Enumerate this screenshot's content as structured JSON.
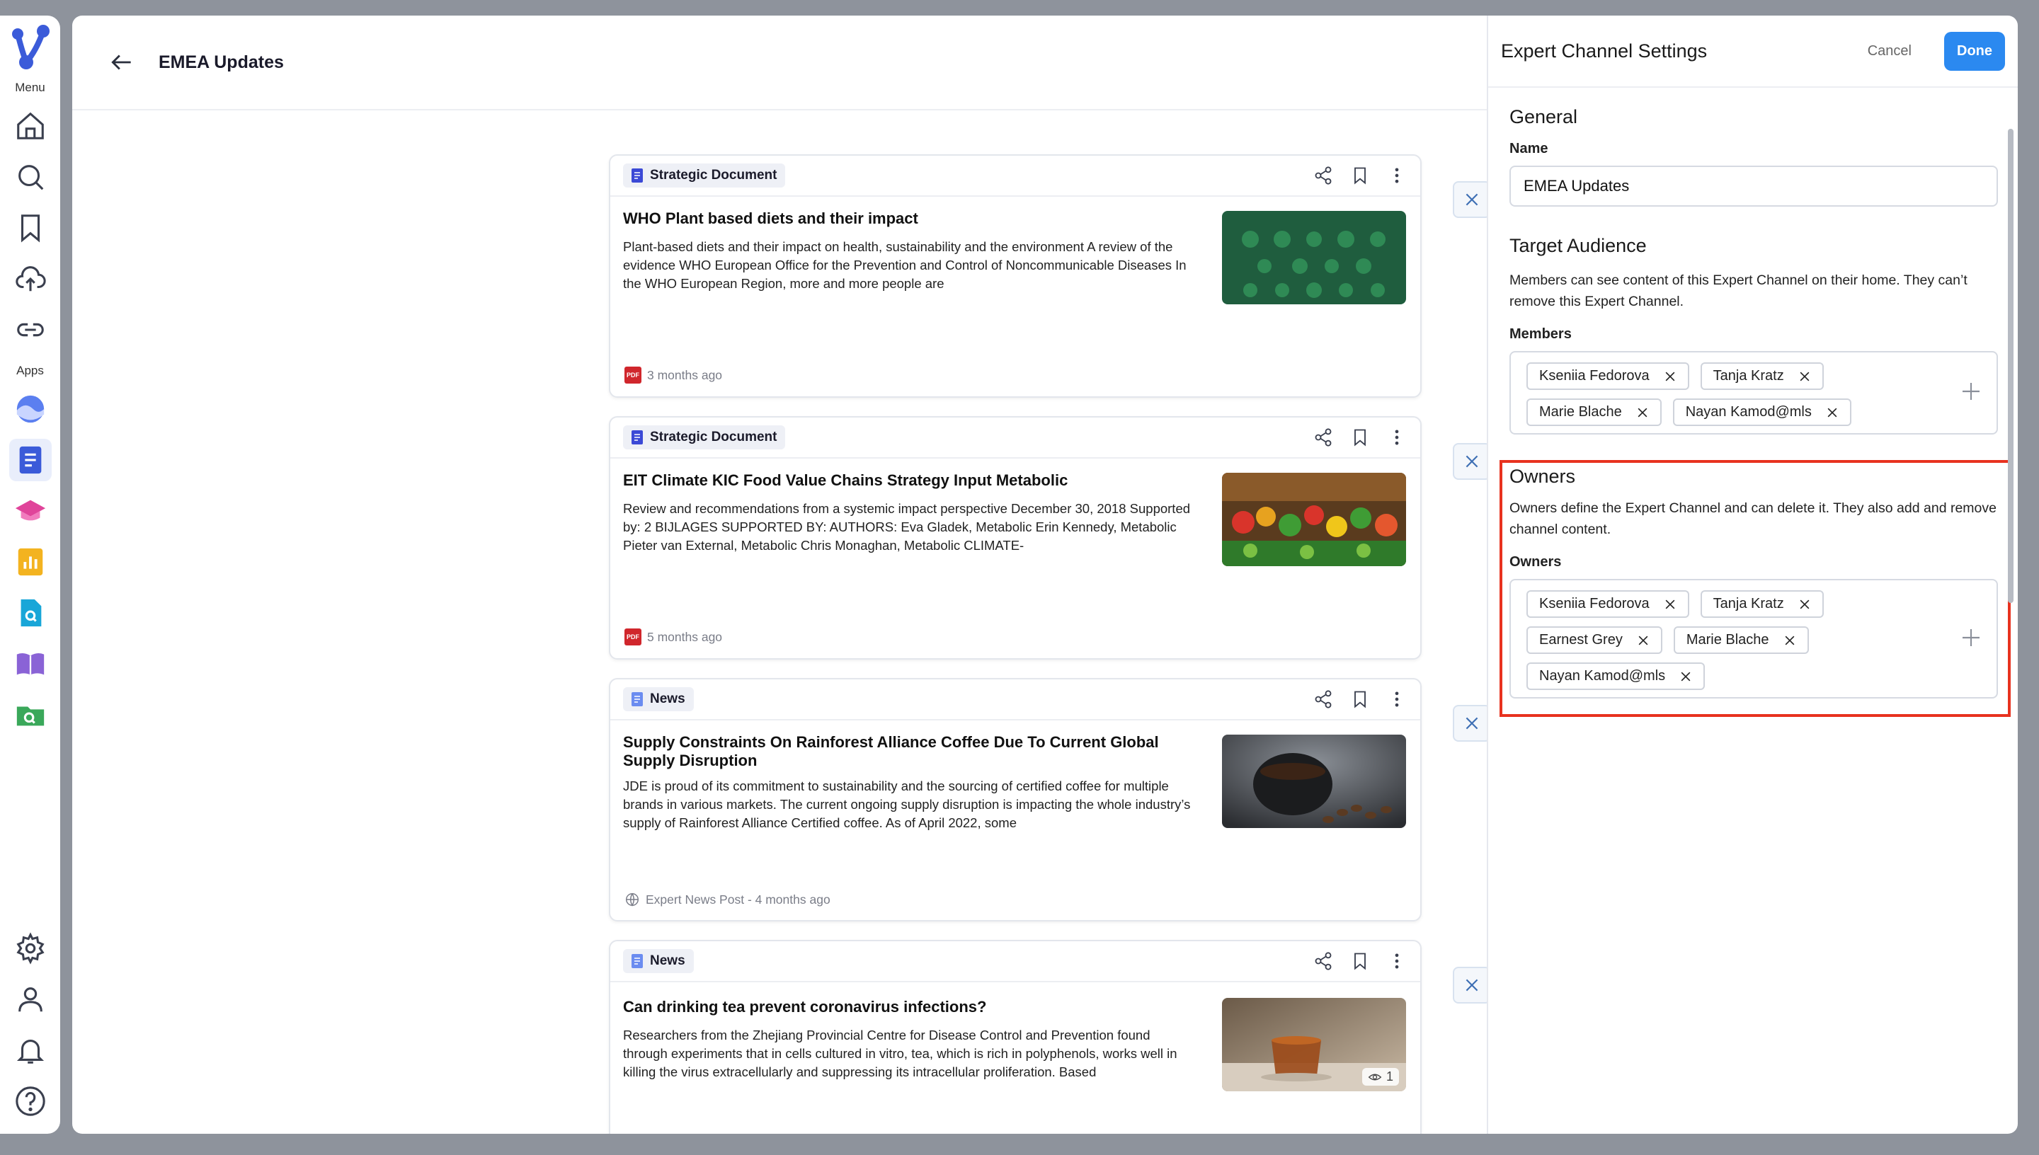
{
  "rail": {
    "menu_label": "Menu",
    "apps_label": "Apps"
  },
  "header": {
    "title": "EMEA Updates"
  },
  "cards": [
    {
      "tag": "Strategic Document",
      "title": "WHO Plant based diets and their impact",
      "desc": "Plant-based diets and their impact on health, sustainability and the environment A review of the evidence WHO European Office for the Prevention and Control of Noncommunicable Diseases In the WHO European Region, more and more people are",
      "meta": "3 months ago",
      "meta_icon": "pdf-icon",
      "thumb": "vegetables-icons"
    },
    {
      "tag": "Strategic Document",
      "title": "EIT Climate KIC Food Value Chains Strategy Input Metabolic",
      "desc": "Review and recommendations from a systemic impact perspective December 30, 2018 Supported by: 2 BIJLAGES SUPPORTED BY: AUTHORS: Eva Gladek, Metabolic Erin Kennedy, Metabolic Pieter van External, Metabolic Chris Monaghan, Metabolic CLIMATE-",
      "meta": "5 months ago",
      "meta_icon": "pdf-icon",
      "thumb": "market-produce"
    },
    {
      "tag": "News",
      "title": "Supply Constraints On Rainforest Alliance Coffee Due To Current Global Supply Disruption",
      "desc": "JDE is proud of its commitment to sustainability and the sourcing of certified coffee for multiple brands in various markets. The current ongoing supply disruption is impacting the whole industry’s supply of Rainforest Alliance Certified coffee. As of April 2022, some",
      "meta": "Expert News Post - 4 months ago",
      "meta_icon": "globe-icon",
      "thumb": "coffee-cup"
    },
    {
      "tag": "News",
      "title": "Can drinking tea prevent coronavirus infections?",
      "desc": "Researchers from the Zhejiang Provincial Centre for Disease Control and Prevention found through experiments that in cells cultured in vitro, tea, which is rich in polyphenols, works well in killing the virus extracellularly and suppressing its intracellular proliferation. Based",
      "meta": "",
      "meta_icon": "",
      "thumb": "tea-cup",
      "views": "1"
    }
  ],
  "settings": {
    "title": "Expert Channel Settings",
    "cancel_label": "Cancel",
    "done_label": "Done",
    "general": {
      "heading": "General",
      "name_label": "Name",
      "name_value": "EMEA Updates"
    },
    "audience": {
      "heading": "Target Audience",
      "desc": "Members can see content of this Expert Channel on their home. They can’t remove this Expert Channel.",
      "members_label": "Members",
      "members": [
        "Kseniia Fedorova",
        "Tanja Kratz",
        "Marie Blache",
        "Nayan Kamod@mls"
      ]
    },
    "owners": {
      "heading": "Owners",
      "desc": "Owners define the Expert Channel and can delete it. They also add and remove channel content.",
      "owners_label": "Owners",
      "owners": [
        "Kseniia Fedorova",
        "Tanja Kratz",
        "Earnest Grey",
        "Marie Blache",
        "Nayan Kamod@mls"
      ]
    }
  },
  "colors": {
    "accent": "#2b89f0",
    "highlight": "#e8321f"
  }
}
